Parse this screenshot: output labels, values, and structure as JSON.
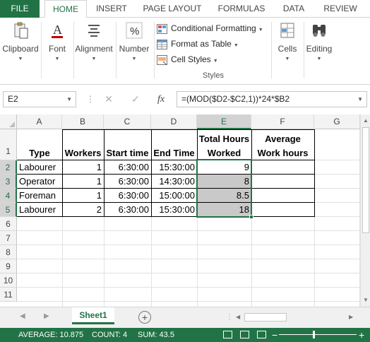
{
  "ribbon_tabs": [
    "FILE",
    "HOME",
    "INSERT",
    "PAGE LAYOUT",
    "FORMULAS",
    "DATA",
    "REVIEW"
  ],
  "ribbon": {
    "clipboard": "Clipboard",
    "font": "Font",
    "alignment": "Alignment",
    "number": "Number",
    "conditional_formatting": "Conditional Formatting",
    "format_as_table": "Format as Table",
    "cell_styles": "Cell Styles",
    "styles_group": "Styles",
    "cells": "Cells",
    "editing": "Editing"
  },
  "formula_bar": {
    "name_box": "E2",
    "cancel": "✕",
    "enter": "✓",
    "fx": "fx",
    "formula": "=(MOD($D2-$C2,1))*24*$B2"
  },
  "columns": [
    "A",
    "B",
    "C",
    "D",
    "E",
    "F",
    "G"
  ],
  "rows": [
    "1",
    "2",
    "3",
    "4",
    "5",
    "6",
    "7",
    "8",
    "9",
    "10",
    "11"
  ],
  "headers": {
    "type": "Type",
    "workers": "Workers",
    "start": "Start time",
    "end": "End Time",
    "total_1": "Total Hours",
    "total_2": "Worked",
    "avg_1": "Average",
    "avg_2": "Work hours"
  },
  "data_rows": [
    {
      "type": "Labourer",
      "workers": "1",
      "start": "6:30:00",
      "end": "15:30:00",
      "total": "9"
    },
    {
      "type": "Operator",
      "workers": "1",
      "start": "6:30:00",
      "end": "14:30:00",
      "total": "8"
    },
    {
      "type": "Foreman",
      "workers": "1",
      "start": "6:30:00",
      "end": "15:00:00",
      "total": "8.5"
    },
    {
      "type": "Labourer",
      "workers": "2",
      "start": "6:30:00",
      "end": "15:30:00",
      "total": "18"
    }
  ],
  "sheet_tab": "Sheet1",
  "status": {
    "average": "AVERAGE: 10.875",
    "count": "COUNT: 4",
    "sum": "SUM: 43.5"
  },
  "colors": {
    "accent": "#217346",
    "selection_fill": "#c9c9c9"
  }
}
